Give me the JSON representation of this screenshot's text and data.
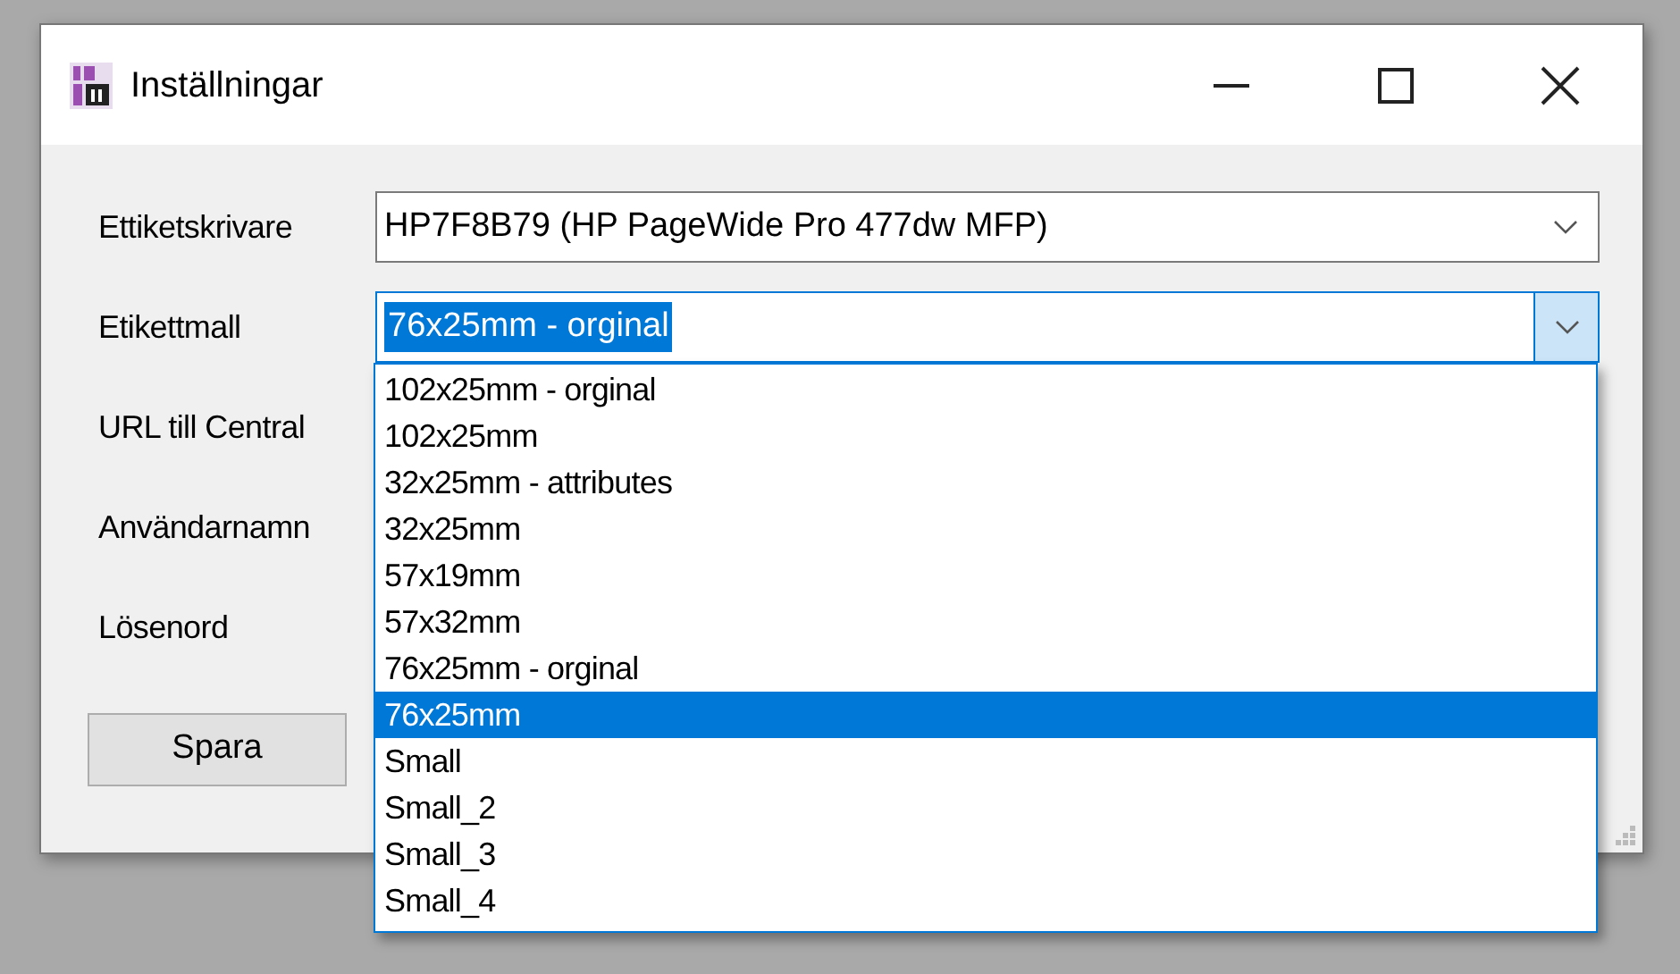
{
  "window": {
    "title": "Inställningar"
  },
  "fields": [
    {
      "label": "Ettiketskrivare",
      "kind": "combo",
      "value": "HP7F8B79 (HP PageWide Pro 477dw MFP)",
      "focused": false
    },
    {
      "label": "Etikettmall",
      "kind": "combo",
      "value": "76x25mm - orginal",
      "focused": true
    },
    {
      "label": "URL till Central",
      "kind": "hidden"
    },
    {
      "label": "Användarnamn",
      "kind": "hidden"
    },
    {
      "label": "Lösenord",
      "kind": "hidden"
    }
  ],
  "dropdown": {
    "options": [
      {
        "label": "102x25mm - orginal",
        "selected": false
      },
      {
        "label": "102x25mm",
        "selected": false
      },
      {
        "label": "32x25mm - attributes",
        "selected": false
      },
      {
        "label": "32x25mm",
        "selected": false
      },
      {
        "label": "57x19mm",
        "selected": false
      },
      {
        "label": "57x32mm",
        "selected": false
      },
      {
        "label": "76x25mm - orginal",
        "selected": false
      },
      {
        "label": "76x25mm",
        "selected": true
      },
      {
        "label": "Small",
        "selected": false
      },
      {
        "label": "Small_2",
        "selected": false
      },
      {
        "label": "Small_3",
        "selected": false
      },
      {
        "label": "Small_4",
        "selected": false
      }
    ]
  },
  "buttons": [
    "Spara"
  ]
}
